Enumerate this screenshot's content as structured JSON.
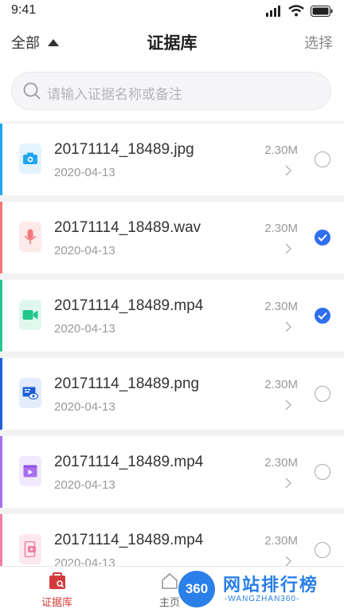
{
  "status": {
    "time": "9:41"
  },
  "navbar": {
    "filter_label": "全部",
    "title": "证据库",
    "select_label": "选择"
  },
  "search": {
    "placeholder": "请输入证据名称或备注"
  },
  "items": [
    {
      "name": "20171114_18489.jpg",
      "date": "2020-04-13",
      "size": "2.30M",
      "type": "photo",
      "accent": "#1fa6f0",
      "icon_bg": "#e3f3fd",
      "selected": false
    },
    {
      "name": "20171114_18489.wav",
      "date": "2020-04-13",
      "size": "2.30M",
      "type": "audio",
      "accent": "#f07878",
      "icon_bg": "#fde9e9",
      "selected": true
    },
    {
      "name": "20171114_18489.mp4",
      "date": "2020-04-13",
      "size": "2.30M",
      "type": "video",
      "accent": "#22c78e",
      "icon_bg": "#e0f7ee",
      "selected": true
    },
    {
      "name": "20171114_18489.png",
      "date": "2020-04-13",
      "size": "2.30M",
      "type": "screen",
      "accent": "#1e5fd8",
      "icon_bg": "#e3ecfb",
      "selected": false
    },
    {
      "name": "20171114_18489.mp4",
      "date": "2020-04-13",
      "size": "2.30M",
      "type": "media",
      "accent": "#a86ff0",
      "icon_bg": "#f1e9fd",
      "selected": false
    },
    {
      "name": "20171114_18489.mp4",
      "date": "2020-04-13",
      "size": "2.30M",
      "type": "phone",
      "accent": "#f07ea6",
      "icon_bg": "#fde8f0",
      "selected": false
    }
  ],
  "tabbar": {
    "evidence_label": "证据库",
    "home_label": "主页",
    "active_color": "#d23b3b"
  },
  "watermark": {
    "badge": "360",
    "text": "网站排行榜",
    "sub": "-WANGZHAN360-"
  }
}
